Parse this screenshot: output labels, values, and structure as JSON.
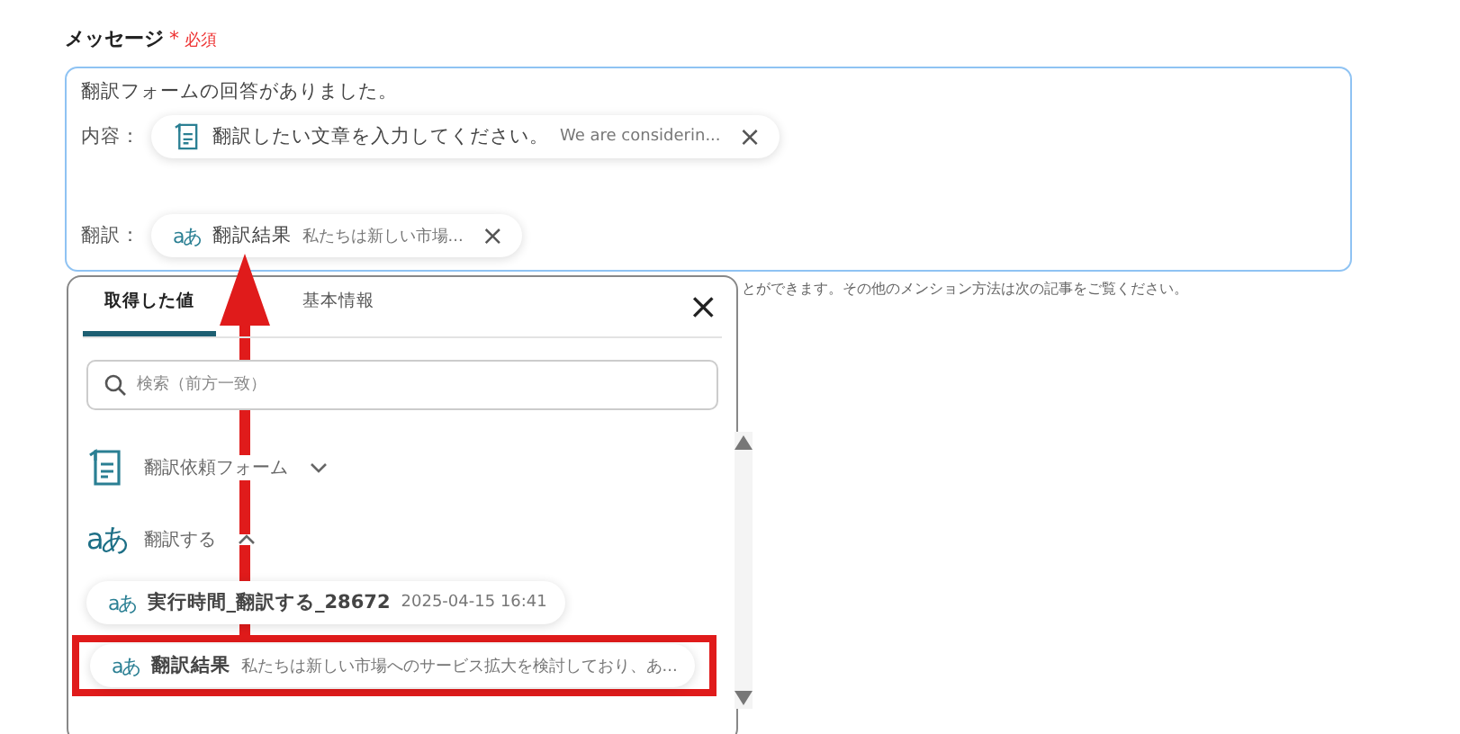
{
  "field": {
    "label": "メッセージ",
    "required_mark": "*",
    "required_text": "必須",
    "lines": [
      {
        "kind": "text",
        "text": "翻訳フォームの回答がありました。"
      },
      {
        "kind": "chip_line",
        "prefix": "内容：",
        "chip": {
          "kind": "form",
          "label": "翻訳したい文章を入力してください。",
          "value": "We are considerin...",
          "close": "×"
        }
      },
      {
        "kind": "blank"
      },
      {
        "kind": "chip_line",
        "prefix": "翻訳：",
        "chip": {
          "kind": "translate",
          "glyph": "aあ",
          "label": "翻訳結果",
          "value": "私たちは新しい市場...",
          "close": "×"
        }
      }
    ],
    "hint": "とができます。その他のメンション方法は次の記事をご覧ください。"
  },
  "picker": {
    "close": "×",
    "tabs": [
      {
        "label": "取得した値",
        "selected": true
      },
      {
        "label": "基本情報",
        "selected": false
      }
    ],
    "search": {
      "placeholder": "検索（前方一致）"
    },
    "groups": [
      {
        "kind": "form",
        "label": "翻訳依頼フォーム",
        "expanded": false
      },
      {
        "kind": "translate",
        "glyph": "aあ",
        "label": "翻訳する",
        "expanded": true,
        "children": [
          {
            "glyph": "aあ",
            "label": "実行時間_翻訳する_28672",
            "value": "2025-04-15 16:41",
            "highlighted": false
          },
          {
            "glyph": "aあ",
            "label": "翻訳結果",
            "value": "私たちは新しい市場へのサービス拡大を検討しており、あ...",
            "highlighted": true
          }
        ]
      }
    ]
  }
}
